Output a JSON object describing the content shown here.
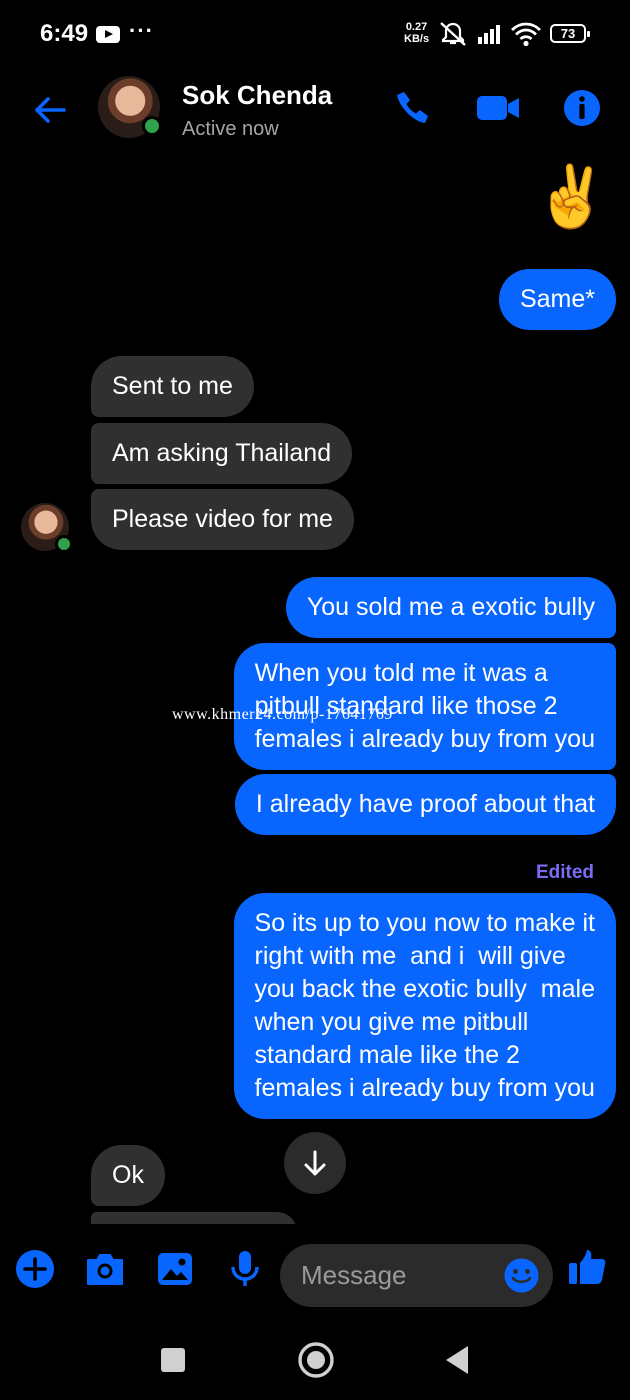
{
  "status_bar": {
    "time": "6:49",
    "more": "···",
    "speed_value": "0.27",
    "speed_unit": "KB/s",
    "battery": "73"
  },
  "header": {
    "contact_name": "Sok Chenda",
    "contact_status": "Active now",
    "accent_color": "#0866ff"
  },
  "messages": [
    {
      "direction": "outgoing",
      "type": "emoji",
      "text": "✌️"
    },
    {
      "direction": "outgoing",
      "text": "Same*"
    },
    {
      "direction": "incoming",
      "text": "Sent to me"
    },
    {
      "direction": "incoming",
      "text": "Am asking Thailand"
    },
    {
      "direction": "incoming",
      "text": "Please video for me"
    },
    {
      "direction": "outgoing",
      "text": "You sold me a exotic bully"
    },
    {
      "direction": "outgoing",
      "text": "When you told me it was a\npitbull standard like those 2\nfemales i already buy from you"
    },
    {
      "direction": "outgoing",
      "text": "I already have proof about that"
    },
    {
      "direction": "outgoing",
      "text": "So its up to you now to make it\nright with me  and i  will give\nyou back the exotic bully  male\nwhen you give me pitbull\nstandard male like the 2\nfemales i already buy from you",
      "edited_label": "Edited"
    },
    {
      "direction": "incoming",
      "text": "Ok"
    }
  ],
  "watermark": "www.khmer24.com/p-17641769",
  "composer": {
    "placeholder": "Message"
  },
  "icons": {
    "status": [
      "youtube-icon",
      "mute-icon",
      "signal-icon",
      "wifi-icon",
      "battery-icon"
    ],
    "header": [
      "back-arrow-icon",
      "phone-icon",
      "video-camera-icon",
      "info-icon"
    ],
    "composer": [
      "plus-icon",
      "camera-icon",
      "image-icon",
      "microphone-icon",
      "emoji-icon",
      "thumbs-up-icon"
    ],
    "nav": [
      "recents-icon",
      "home-icon",
      "back-icon"
    ]
  }
}
